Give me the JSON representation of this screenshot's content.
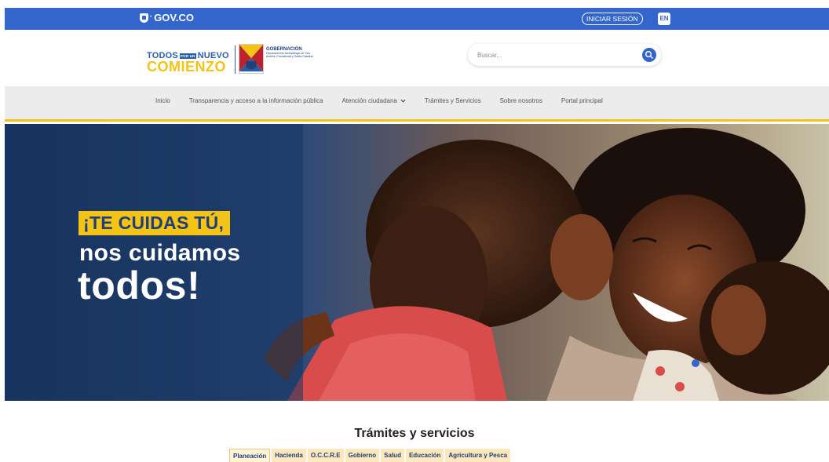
{
  "govbar": {
    "brand": "GOV.CO",
    "login_label": "INICIAR SESIÓN",
    "lang_label": "EN"
  },
  "header": {
    "logo": {
      "line1_left": "TODOS",
      "line1_small": "POR UN",
      "line1_right": "NUEVO",
      "line2": "COMIENZO",
      "gob_title": "GOBERNACIÓN",
      "gob_subtitle": "Departamento Archipiélago de San Andrés, Providencia y Santa Catalina"
    },
    "search": {
      "placeholder": "Buscar..."
    }
  },
  "nav": {
    "items": [
      {
        "label": "Inicio"
      },
      {
        "label": "Transparencia y acceso a la información pública"
      },
      {
        "label": "Atención ciudadana"
      },
      {
        "label": "Trámites y Servicios"
      },
      {
        "label": "Sobre nosotros"
      },
      {
        "label": "Portal principal"
      }
    ]
  },
  "hero": {
    "line1": "¡TE CUIDAS TÚ,",
    "line2": "nos cuidamos",
    "line3": "todos!"
  },
  "tramites": {
    "title": "Trámites y servicios",
    "tabs": [
      {
        "label": "Planeación",
        "active": true
      },
      {
        "label": "Hacienda"
      },
      {
        "label": "O.C.C.R.E"
      },
      {
        "label": "Gobierno"
      },
      {
        "label": "Salud"
      },
      {
        "label": "Educación"
      },
      {
        "label": "Agricultura y Pesca"
      }
    ]
  },
  "colors": {
    "gov_blue": "#3366cc",
    "accent_yellow": "#f3c316",
    "brand_navy": "#1f3f7a",
    "tab_bg": "#fde7bd"
  }
}
